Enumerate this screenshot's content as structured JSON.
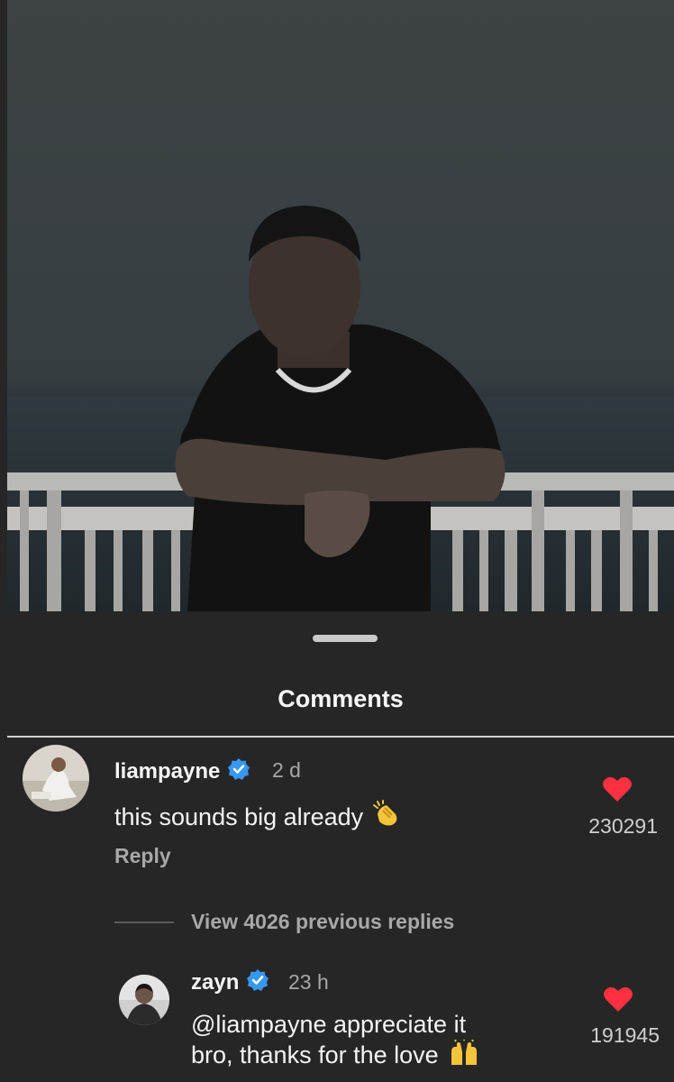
{
  "sheet": {
    "title": "Comments",
    "view_replies_label": "View 4026 previous replies"
  },
  "comments": [
    {
      "username": "liampayne",
      "verified": true,
      "time": "2 d",
      "text": "this sounds big already",
      "emoji": "clapping-hands",
      "reply_label": "Reply",
      "likes": "230291"
    },
    {
      "username": "zayn",
      "verified": true,
      "time": "23 h",
      "text_line1": "@liampayne appreciate it",
      "text_line2": "bro, thanks for the love",
      "emoji": "raising-hands",
      "likes": "191945"
    }
  ],
  "colors": {
    "sheet_background": "#262626",
    "like_heart": "#ff3040",
    "verified_badge": "#3897f0",
    "secondary_text": "#a8a8a8"
  }
}
